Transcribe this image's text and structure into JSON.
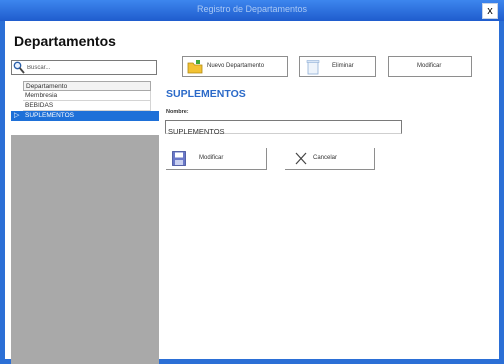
{
  "window": {
    "title": "Registro de Departamentos",
    "close_glyph": "x"
  },
  "app": {
    "heading": "Departamentos"
  },
  "search": {
    "placeholder": "Buscar..."
  },
  "toolbar": {
    "new_label": "Nuevo Departamento",
    "delete_label": "Eliminar",
    "modify_label": "Modificar"
  },
  "list": {
    "header": "Departamento",
    "rows": [
      "Membresia",
      "BEBIDAS",
      "SUPLEMENTOS"
    ],
    "selected_index": 2,
    "selected_indicator": "▷"
  },
  "detail": {
    "title": "SUPLEMENTOS",
    "name_label": "Nombre:",
    "name_value": "SUPLEMENTOS",
    "modify_label": "Modificar",
    "cancel_label": "Cancelar"
  },
  "colors": {
    "title_bar": "#2b6fd6",
    "selection": "#1e70d8",
    "heading_accent": "#2a69c8",
    "sidebar_bg": "#a9a9a9"
  }
}
